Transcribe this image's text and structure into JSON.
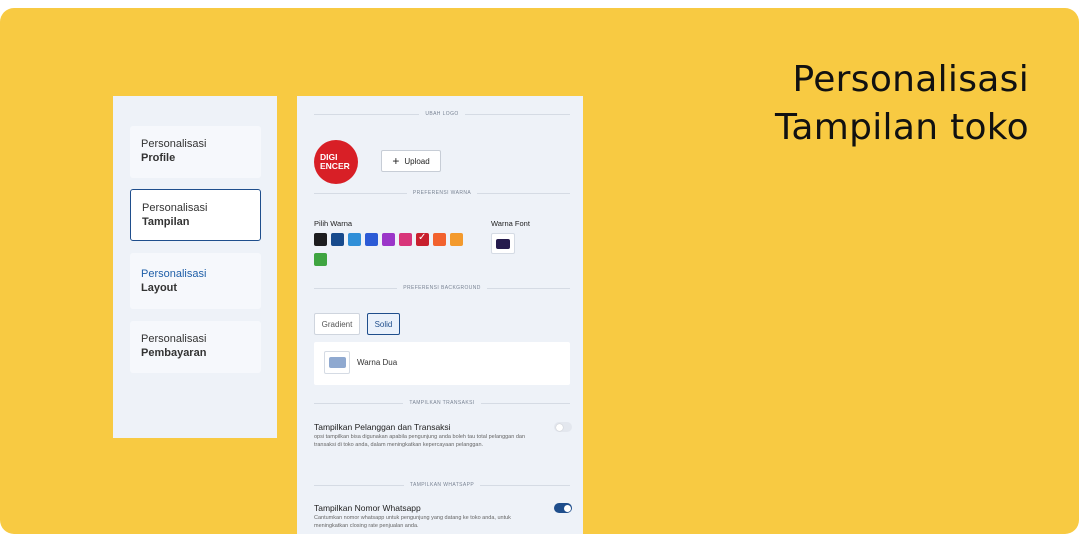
{
  "headline": {
    "line1": "Personalisasi",
    "line2": "Tampilan toko"
  },
  "nav": {
    "items": [
      {
        "line1": "Personalisasi",
        "line2": "Profile"
      },
      {
        "line1": "Personalisasi",
        "line2": "Tampilan"
      },
      {
        "line1": "Personalisasi",
        "line2": "Layout"
      },
      {
        "line1": "Personalisasi",
        "line2": "Pembayaran"
      }
    ]
  },
  "logo_section": {
    "title": "UBAH LOGO",
    "logo_line1": "DIGI",
    "logo_line2": "ENCER",
    "upload_label": "Upload"
  },
  "color_section": {
    "title": "PREFERENSI WARNA",
    "pick_label": "Pilih Warna",
    "font_label": "Warna Font",
    "swatches": [
      "#1D1D1F",
      "#174A8C",
      "#2F8FD8",
      "#2C5BD6",
      "#9B36C9",
      "#D8357A",
      "#C8202E",
      "#F2622E",
      "#F39A2D",
      "#3FA541"
    ],
    "selected_swatch": "#C8202E",
    "font_color": "#251B4D"
  },
  "background_section": {
    "title": "PREFERENSI BACKGROUND",
    "options": [
      "Gradient",
      "Solid"
    ],
    "selected": "Solid",
    "color_label": "Warna Dua",
    "color": "#8FA9D0"
  },
  "transaction_section": {
    "title": "TAMPILKAN TRANSAKSI",
    "option_title": "Tampilkan Pelanggan dan Transaksi",
    "option_desc": "opsi tampilkan bisa digunakan apabila pengunjung anda boleh tau total pelanggan dan transaksi di toko anda, dalam meningkatkan kepercayaan pelanggan.",
    "enabled": false
  },
  "whatsapp_section": {
    "title": "TAMPILKAN WHATSAPP",
    "option_title": "Tampilkan Nomor Whatsapp",
    "option_desc": "Cantumkan nomor whatsapp untuk pengunjung yang datang ke toko anda, untuk meningkatkan closing rate penjualan anda.",
    "enabled": true
  }
}
